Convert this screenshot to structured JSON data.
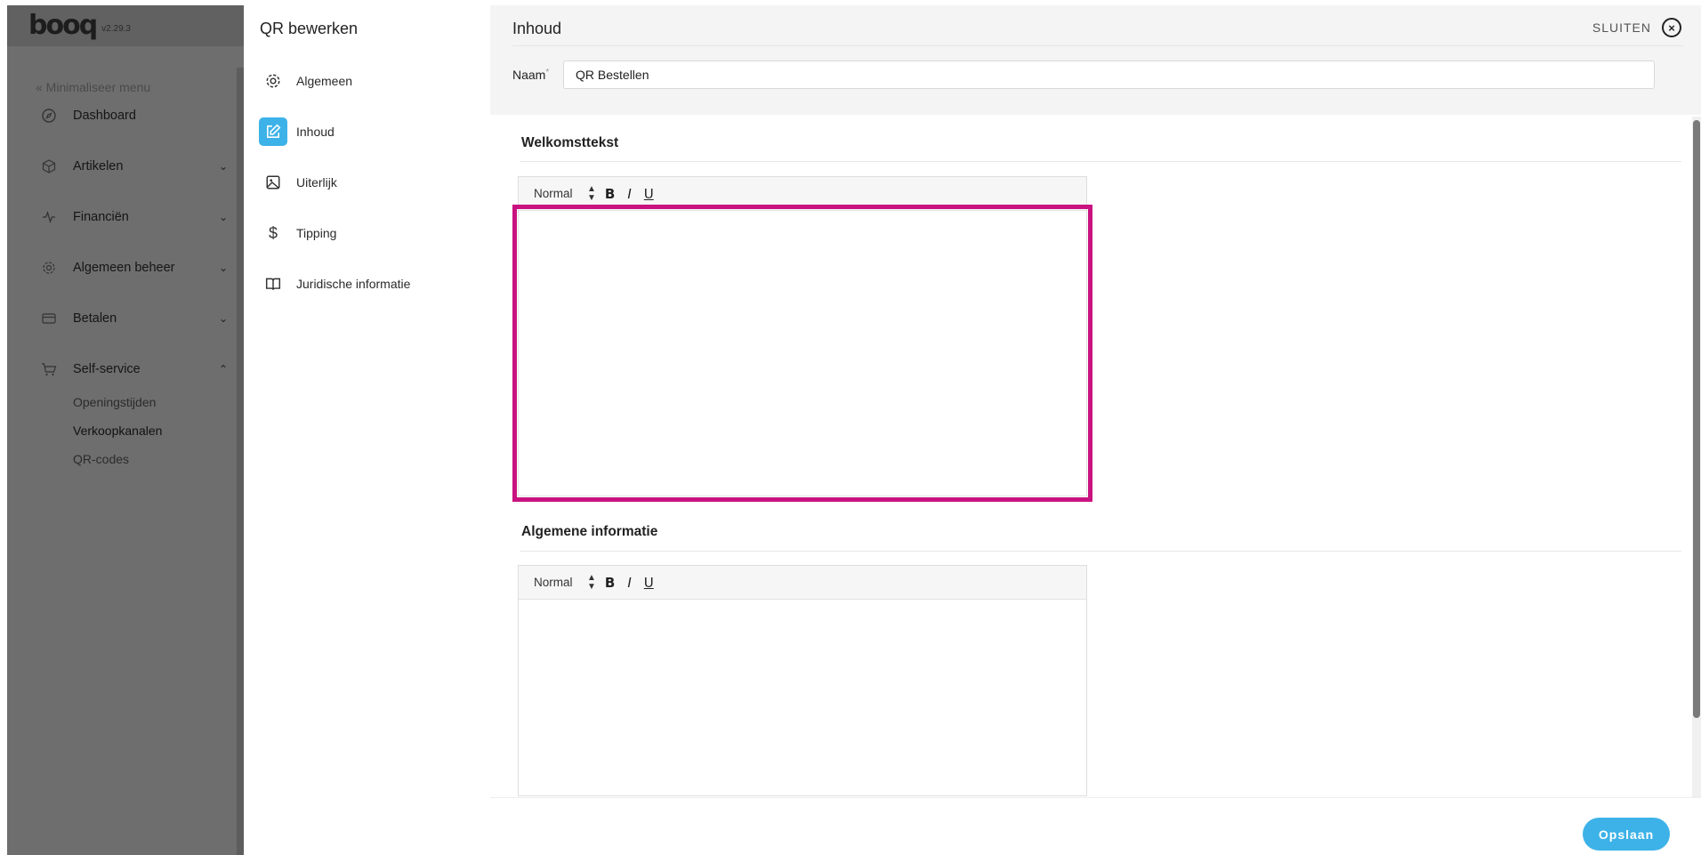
{
  "app": {
    "logo_text": "booq",
    "version": "v2.29.3"
  },
  "sidebar": {
    "minimize_label": "« Minimaliseer menu",
    "items": [
      {
        "label": "Dashboard",
        "icon": "compass-icon",
        "has_chevron": false
      },
      {
        "label": "Artikelen",
        "icon": "box-icon",
        "has_chevron": true,
        "chevron": "⌄"
      },
      {
        "label": "Financiën",
        "icon": "activity-icon",
        "has_chevron": true,
        "chevron": "⌄"
      },
      {
        "label": "Algemeen beheer",
        "icon": "gear-icon",
        "has_chevron": true,
        "chevron": "⌄"
      },
      {
        "label": "Betalen",
        "icon": "credit-card-icon",
        "has_chevron": true,
        "chevron": "⌄"
      },
      {
        "label": "Self-service",
        "icon": "cart-icon",
        "has_chevron": true,
        "chevron": "⌃"
      }
    ],
    "subitems": [
      {
        "label": "Openingstijden"
      },
      {
        "label": "Verkoopkanalen",
        "active": true
      },
      {
        "label": "QR-codes"
      }
    ]
  },
  "edit_panel": {
    "title": "QR bewerken",
    "items": [
      {
        "label": "Algemeen",
        "icon": "gear-icon"
      },
      {
        "label": "Inhoud",
        "icon": "edit-icon",
        "active": true
      },
      {
        "label": "Uiterlijk",
        "icon": "image-icon"
      },
      {
        "label": "Tipping",
        "icon": "dollar-icon"
      },
      {
        "label": "Juridische informatie",
        "icon": "book-icon"
      }
    ]
  },
  "content": {
    "title": "Inhoud",
    "close_label": "SLUITEN",
    "name_label": "Naam",
    "name_required_mark": "*",
    "name_value": "QR Bestellen",
    "sections": [
      {
        "title": "Welkomsttekst",
        "format": "Normal",
        "bold": "B",
        "italic": "I",
        "underline": "U",
        "highlighted": true
      },
      {
        "title": "Algemene informatie",
        "format": "Normal",
        "bold": "B",
        "italic": "I",
        "underline": "U",
        "highlighted": false
      }
    ],
    "save_label": "Opslaan"
  },
  "colors": {
    "accent": "#3db2e8",
    "highlight": "#c9127f",
    "overlay": "#6e6e6e"
  }
}
